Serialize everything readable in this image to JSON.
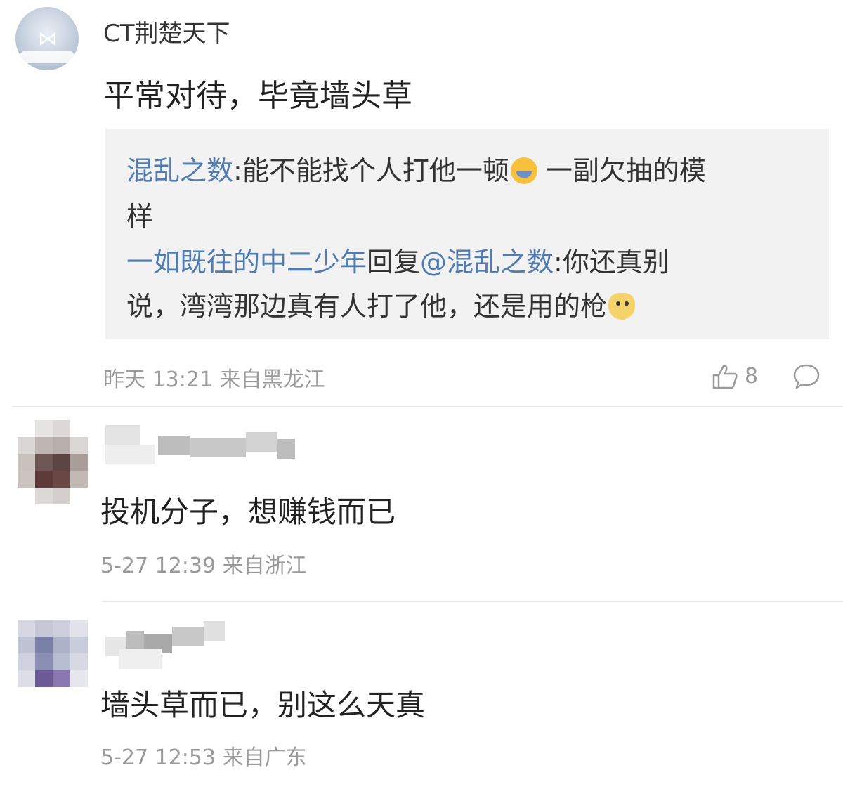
{
  "comments": [
    {
      "username": "CT荆楚天下",
      "text": "平常对待，毕竟墙头草",
      "quote": {
        "line1_user": "混乱之数",
        "line1_text": ":能不能找个人打他一顿",
        "line1_text_after": "一副欠抽的模",
        "line2_text": "样",
        "line3_user": "一如既往的中二少年",
        "line3_reply": "回复",
        "line3_mention": "@混乱之数",
        "line3_text": ":你还真别",
        "line4_text": "说，湾湾那边真有人打了他，还是用的枪"
      },
      "time": "昨天 13:21",
      "location": "来自黑龙江",
      "like_count": "8",
      "icons": {
        "avatar": "avatar",
        "like": "thumbs-up-icon",
        "comment": "comment-bubble-icon"
      }
    },
    {
      "username": "",
      "text": "投机分子，想赚钱而已",
      "time": "5-27 12:39",
      "location": "来自浙江"
    },
    {
      "username": "",
      "text": "墙头草而已，别这么天真",
      "time": "5-27 12:53",
      "location": "来自广东"
    }
  ],
  "colors": {
    "link": "#4f7cb3",
    "meta": "#9a9a9a",
    "quote_bg": "#f2f2f2"
  }
}
